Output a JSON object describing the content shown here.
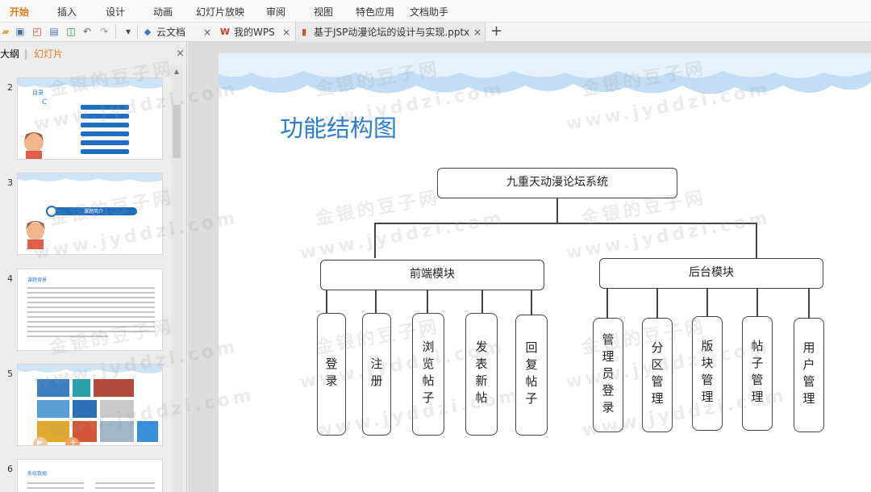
{
  "menu": {
    "items": [
      "开始",
      "插入",
      "设计",
      "动画",
      "幻灯片放映",
      "审阅",
      "视图",
      "特色应用",
      "文档助手"
    ]
  },
  "tabs": {
    "cloud": "云文档",
    "mywps": "我的WPS",
    "document": "基于JSP动漫论坛的设计与实现.pptx",
    "close": "×",
    "new_tab": "+"
  },
  "left_panel": {
    "outline_tab": "大纲",
    "slides_tab": "幻灯片",
    "close": "×",
    "slide_numbers": [
      "2",
      "3",
      "4",
      "5",
      "6"
    ],
    "thumb2": {
      "title": "目录",
      "items": [
        "课题简介",
        "功能结构图",
        "系统功能",
        "数据库设计",
        "测试",
        "总结"
      ]
    },
    "thumb3": {
      "banner": "课题简介"
    },
    "thumb4": {
      "title": "课题背景"
    },
    "thumb6": {
      "title": "系统数据"
    }
  },
  "slide": {
    "title": "功能结构图",
    "root": "九重天动漫论坛系统",
    "frontend": "前端模块",
    "backend": "后台模块",
    "front_items": [
      "登录",
      "注册",
      "浏览帖子",
      "发表新帖",
      "回复帖子"
    ],
    "back_items": [
      "管理员登录",
      "分区管理",
      "版块管理",
      "帖子管理",
      "用户管理"
    ]
  },
  "watermark": {
    "cn": "金银的豆子网",
    "en": "www.jyddzi.com"
  },
  "colors": {
    "accent": "#e07b18",
    "title_blue": "#2b7dd1"
  },
  "icons": [
    "folder-icon",
    "save-icon",
    "pdf-icon",
    "print-icon",
    "preview-icon",
    "undo-icon",
    "redo-icon",
    "dropdown-icon",
    "cloud-icon",
    "wps-icon",
    "ppt-icon"
  ]
}
